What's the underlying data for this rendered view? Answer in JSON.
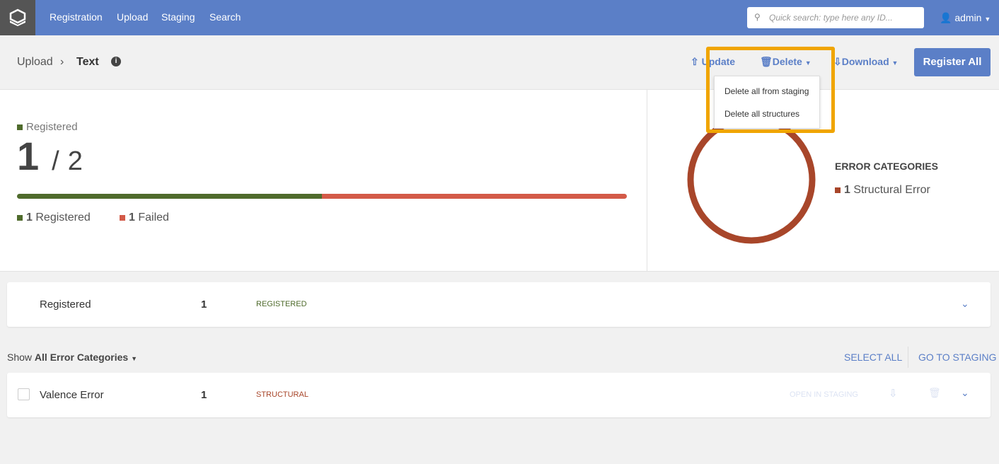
{
  "nav": {
    "items": [
      "Registration",
      "Upload",
      "Staging",
      "Search"
    ],
    "search_placeholder": "Quick search: type here any ID...",
    "user": "admin"
  },
  "breadcrumb": {
    "parent": "Upload",
    "current": "Text"
  },
  "actions": {
    "update": "Update",
    "delete": "Delete",
    "download": "Download",
    "register_all": "Register All"
  },
  "delete_menu": [
    "Delete all from staging",
    "Delete all structures"
  ],
  "summary": {
    "label": "Registered",
    "registered": "1",
    "separator": "/",
    "total": "2",
    "registered_count": "1",
    "registered_label": "Registered",
    "failed_count": "1",
    "failed_label": "Failed",
    "progress_registered_fraction": 0.5
  },
  "errors": {
    "title": "ERROR CATEGORIES",
    "items": [
      {
        "count": "1",
        "label": "Structural Error"
      }
    ]
  },
  "registered_row": {
    "name": "Registered",
    "count": "1",
    "status": "REGISTERED"
  },
  "filter": {
    "show": "Show",
    "value": "All Error Categories",
    "select_all": "SELECT ALL",
    "go_to_staging": "GO TO STAGING"
  },
  "error_row": {
    "name": "Valence Error",
    "count": "1",
    "category": "STRUCTURAL",
    "open": "OPEN IN STAGING"
  },
  "colors": {
    "brand": "#5b7fc7",
    "registered": "#4f6b2c",
    "failed": "#d35a48",
    "structural": "#a8462a",
    "highlight": "#f0a500"
  }
}
